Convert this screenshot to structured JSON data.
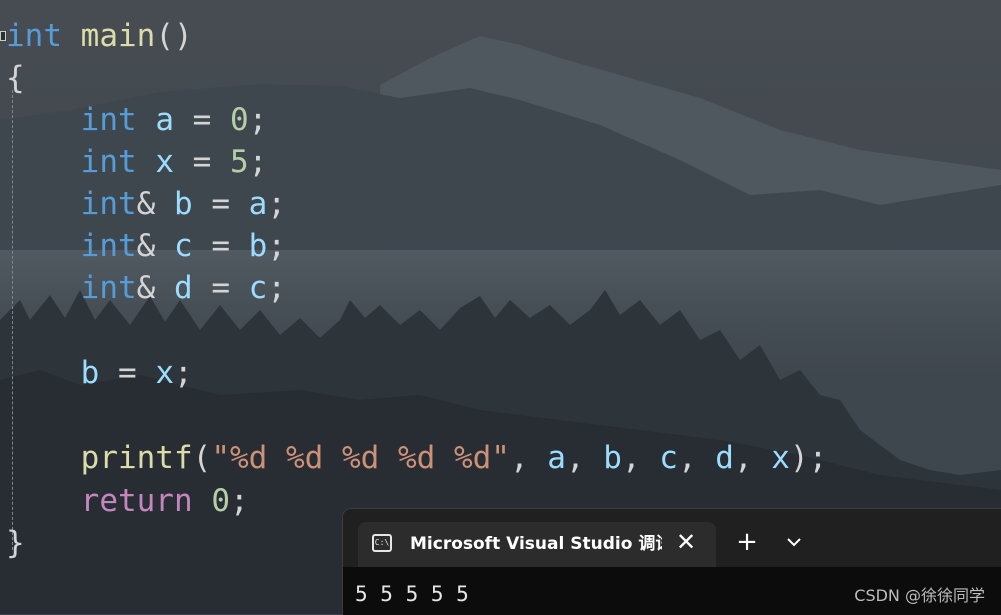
{
  "editor": {
    "code": {
      "l1_kw": "int",
      "l1_fn": "main",
      "l1_rest": "()",
      "l2_brace": "{",
      "l3_kw": "int",
      "l3_var": "a",
      "l3_op": " = ",
      "l3_num": "0",
      "l3_end": ";",
      "l4_kw": "int",
      "l4_var": "x",
      "l4_op": " = ",
      "l4_num": "5",
      "l4_end": ";",
      "l5_kw": "int",
      "l5_amp": "& ",
      "l5_var": "b",
      "l5_op": " = ",
      "l5_var2": "a",
      "l5_end": ";",
      "l6_kw": "int",
      "l6_amp": "& ",
      "l6_var": "c",
      "l6_op": " = ",
      "l6_var2": "b",
      "l6_end": ";",
      "l7_kw": "int",
      "l7_amp": "& ",
      "l7_var": "d",
      "l7_op": " = ",
      "l7_var2": "c",
      "l7_end": ";",
      "l8_var": "b",
      "l8_op": " = ",
      "l8_var2": "x",
      "l8_end": ";",
      "l9_fn": "printf",
      "l9_open": "(",
      "l9_str": "\"%d %d %d %d %d\"",
      "l9_c1": ", ",
      "l9_a": "a",
      "l9_c2": ", ",
      "l9_b": "b",
      "l9_c3": ", ",
      "l9_c": "c",
      "l9_c4": ", ",
      "l9_d": "d",
      "l9_c5": ", ",
      "l9_x": "x",
      "l9_close": ");",
      "l10_kw": "return",
      "l10_sp": " ",
      "l10_num": "0",
      "l10_end": ";",
      "l11_brace": "}"
    }
  },
  "terminal": {
    "tab_title": "Microsoft Visual Studio 调试控制台",
    "tab_icon_label": "C:\\",
    "close_label": "✕",
    "new_tab_label": "+",
    "output": "5 5 5 5 5"
  },
  "watermark": "CSDN @徐徐同学",
  "icons": {
    "terminal": "console-icon",
    "close": "close-icon",
    "new_tab": "plus-icon",
    "dropdown": "chevron-down-icon"
  },
  "colors": {
    "keyword": "#569cd6",
    "control": "#c586c0",
    "function": "#dcdcaa",
    "variable": "#9cdcfe",
    "number": "#b5cea8",
    "string": "#ce9178"
  }
}
